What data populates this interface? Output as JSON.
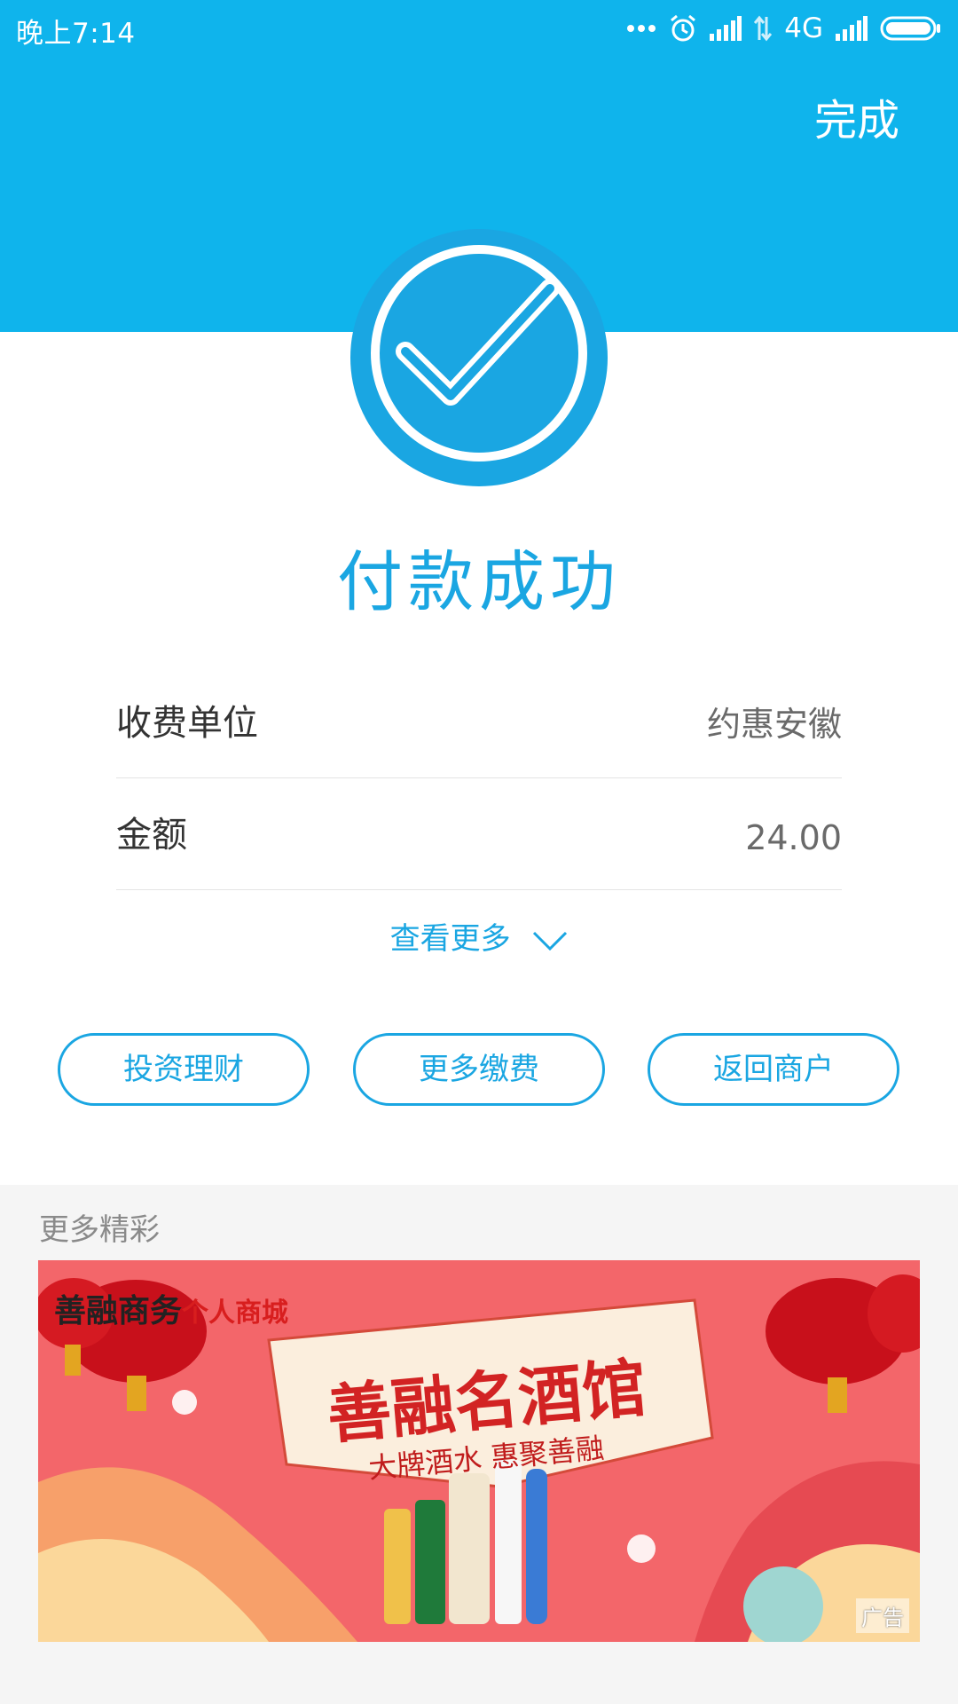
{
  "status_bar": {
    "time": "晚上7:14",
    "network": "4G",
    "icons": [
      "more-dots-icon",
      "alarm-icon",
      "signal-icon",
      "data-transfer-icon",
      "signal-icon",
      "battery-icon"
    ]
  },
  "header": {
    "done_label": "完成",
    "bg_color": "#0fb4ec"
  },
  "result": {
    "title": "付款成功",
    "icon": "check-circle-icon",
    "accent": "#1aa6e2"
  },
  "details": {
    "rows": [
      {
        "label": "收费单位",
        "value": "约惠安徽"
      },
      {
        "label": "金额",
        "value": "24.00"
      }
    ],
    "more_label": "查看更多"
  },
  "actions": [
    "投资理财",
    "更多缴费",
    "返回商户"
  ],
  "promo": {
    "section_title": "更多精彩",
    "banner": {
      "brand": "善融商务",
      "brand_sub": "个人商城",
      "title": "善融名酒馆",
      "subtitle": "大牌酒水 惠聚善融",
      "ad_label": "广告"
    }
  }
}
